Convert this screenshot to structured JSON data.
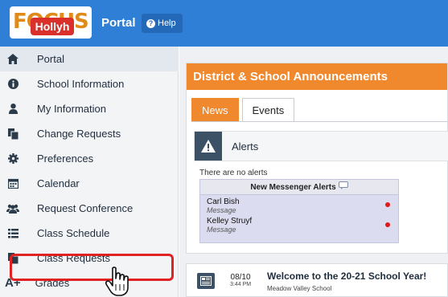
{
  "header": {
    "logo_text": "FOCUS",
    "logo_tag": "Hollyh",
    "app_title": "Portal",
    "help_label": "Help"
  },
  "sidebar": {
    "items": [
      {
        "label": "Portal",
        "icon": "home-icon"
      },
      {
        "label": "School Information",
        "icon": "info-icon"
      },
      {
        "label": "My Information",
        "icon": "person-icon"
      },
      {
        "label": "Change Requests",
        "icon": "documents-icon"
      },
      {
        "label": "Preferences",
        "icon": "gear-icon"
      },
      {
        "label": "Calendar",
        "icon": "calendar-icon"
      },
      {
        "label": "Request Conference",
        "icon": "group-icon"
      },
      {
        "label": "Class Schedule",
        "icon": "list-icon"
      },
      {
        "label": "Class Requests",
        "icon": "documents-icon"
      },
      {
        "label": "Grades",
        "icon": "grades-icon",
        "glyph": "A+"
      }
    ]
  },
  "announcements": {
    "title": "District & School Announcements",
    "tabs": [
      "News",
      "Events"
    ],
    "active_tab": "News"
  },
  "alerts": {
    "title": "Alerts",
    "empty_text": "There are no alerts",
    "messenger_title": "New Messenger Alerts",
    "messages": [
      {
        "from": "Carl Bish",
        "type": "Message"
      },
      {
        "from": "Kelley Struyf",
        "type": "Message"
      }
    ]
  },
  "news_item": {
    "date": "08/10",
    "time": "3:44 PM",
    "title": "Welcome to the 20-21 School Year!",
    "school": "Meadow Valley School"
  },
  "colors": {
    "topbar": "#2f7fd6",
    "accent_orange": "#f0882e",
    "highlight_red": "#e02222",
    "alert_dot": "#e11b1b"
  }
}
